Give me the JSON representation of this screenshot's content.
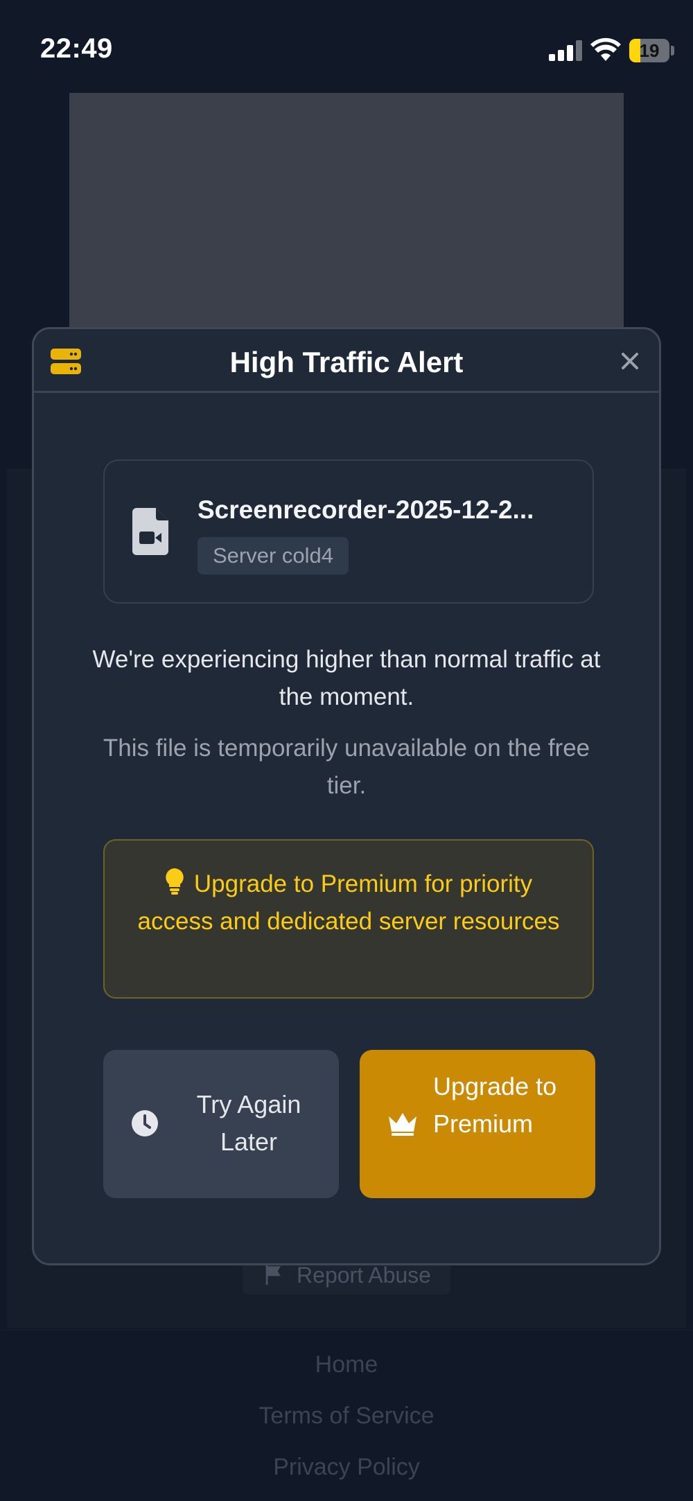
{
  "status_bar": {
    "time": "22:49",
    "battery": "19"
  },
  "modal": {
    "title": "High Traffic Alert",
    "file": {
      "name": "Screenrecorder-2025-12-2...",
      "server": "Server cold4"
    },
    "message_primary": "We're experiencing higher than normal traffic at the moment.",
    "message_secondary": "This file is temporarily unavailable on the free tier.",
    "tip": "Upgrade to Premium for priority access and dedicated server resources",
    "buttons": {
      "try_again": "Try Again Later",
      "upgrade": "Upgrade to Premium"
    }
  },
  "background_page": {
    "report_abuse": "Report Abuse",
    "footer_links": [
      "Home",
      "Terms of Service",
      "Privacy Policy"
    ]
  },
  "colors": {
    "accent": "#ca8a04",
    "tip_text": "#facc15",
    "modal_bg": "#1f2937",
    "page_bg": "#111827"
  }
}
